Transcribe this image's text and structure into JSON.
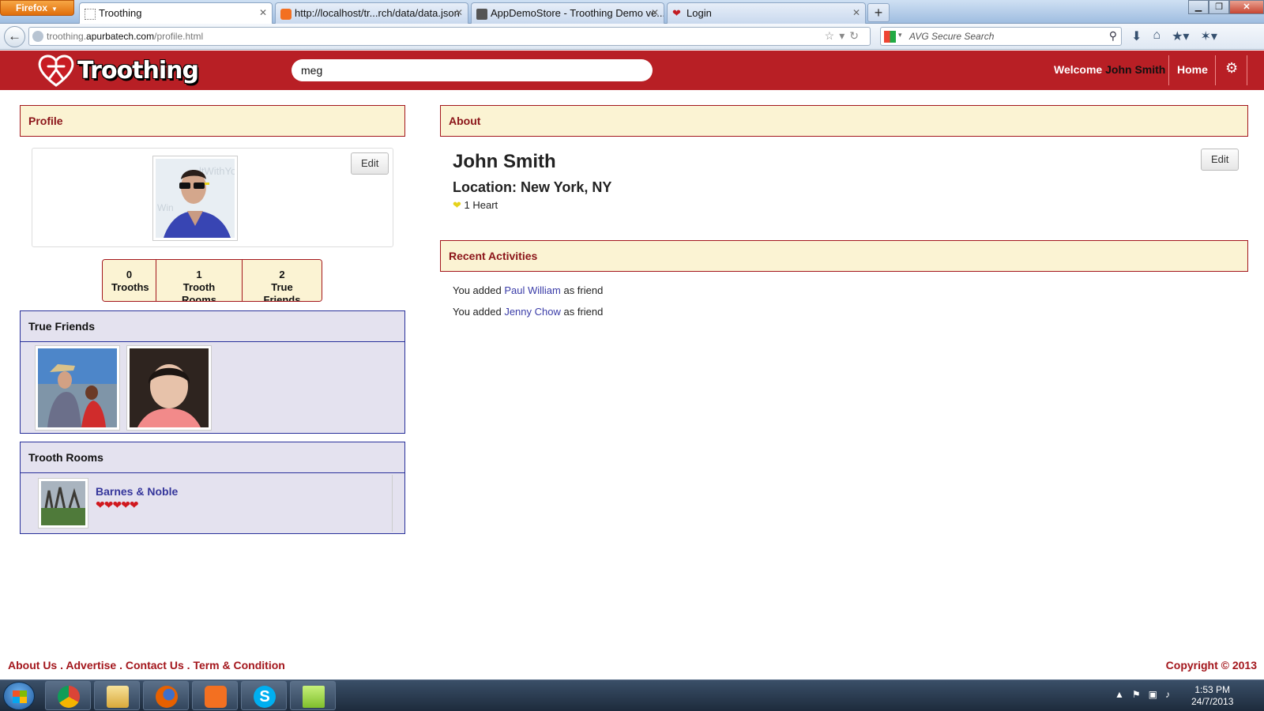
{
  "browser": {
    "menu_button": "Firefox",
    "tabs": [
      {
        "title": "Troothing",
        "active": true
      },
      {
        "title": "http://localhost/tr...rch/data/data.json",
        "active": false
      },
      {
        "title": "AppDemoStore - Troothing Demo ve...",
        "active": false
      },
      {
        "title": "Login",
        "active": false
      }
    ],
    "url_host_prefix": "troothing.",
    "url_host": "apurbatech.com",
    "url_path": "/profile.html",
    "search_placeholder": "AVG Secure Search"
  },
  "site": {
    "logo_text": "Troothing",
    "search_value": "meg",
    "welcome_label": "Welcome",
    "user_name": "John Smith",
    "home_label": "Home",
    "colors": {
      "brand_red": "#b81f25",
      "panel_cream": "#fbf3d3",
      "panel_lavender": "#e4e2ef",
      "link_blue": "#3a3ca8"
    }
  },
  "profile": {
    "heading": "Profile",
    "edit_label": "Edit",
    "stats": [
      {
        "count": "0",
        "label": "Trooths"
      },
      {
        "count": "1",
        "label": "Trooth Rooms"
      },
      {
        "count": "2",
        "label": "True Friends"
      }
    ]
  },
  "true_friends": {
    "heading": "True Friends"
  },
  "trooth_rooms": {
    "heading": "Trooth Rooms",
    "items": [
      {
        "name": "Barnes & Noble",
        "hearts": "❤❤❤❤❤"
      }
    ]
  },
  "about": {
    "heading": "About",
    "edit_label": "Edit",
    "name": "John Smith",
    "location": "Location: New York, NY",
    "hearts_label": "1 Heart"
  },
  "recent_activities": {
    "heading": "Recent Activities",
    "items": [
      {
        "prefix": "You added",
        "friend": "Paul William",
        "suffix": "as friend"
      },
      {
        "prefix": "You added",
        "friend": "Jenny Chow",
        "suffix": "as friend"
      }
    ]
  },
  "footer": {
    "links": [
      "About Us",
      "Advertise",
      "Contact Us",
      "Term & Condition"
    ],
    "separator": " . ",
    "copyright": "Copyright © 2013"
  },
  "taskbar": {
    "time": "1:53 PM",
    "date": "24/7/2013"
  }
}
